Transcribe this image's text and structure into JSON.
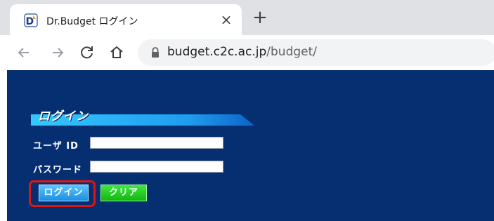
{
  "browser": {
    "tab": {
      "title": "Dr.Budget ログイン",
      "close_glyph": "×",
      "favicon": "dr-budget-favicon"
    },
    "new_tab_glyph": "+",
    "toolbar": {
      "back_icon": "back-arrow-icon",
      "forward_icon": "forward-arrow-icon",
      "reload_icon": "reload-icon",
      "home_icon": "home-icon"
    },
    "address_bar": {
      "host": "budget.c2c.ac.jp",
      "path": "/budget/",
      "lock_icon": "lock-icon"
    }
  },
  "login_form": {
    "heading": "ログイン",
    "user_id_label": "ユーザ ID",
    "user_id_value": "",
    "password_label": "パスワード",
    "password_value": "",
    "login_button": "ログイン",
    "clear_button": "クリア"
  },
  "colors": {
    "page_background": "#062f72",
    "login_button": "#1a8fe0",
    "clear_button": "#14b514",
    "highlight": "#e2150d"
  }
}
